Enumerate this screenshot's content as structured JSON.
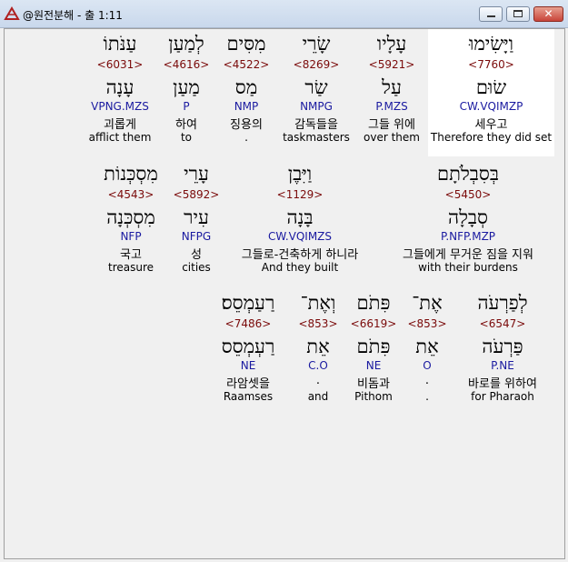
{
  "window": {
    "title": "@원전분해 - 출 1:11"
  },
  "rows": [
    [
      {
        "heb": "וַיָּשִׂימוּ",
        "num": "<7760>",
        "lex": "שׂוּם",
        "mor": "CW.VQIMZP",
        "kor": "세우고",
        "eng": "Therefore they did set"
      },
      {
        "heb": "עָלָיו",
        "num": "<5921>",
        "lex": "עַל",
        "mor": "P.MZS",
        "kor": "그들 위에",
        "eng": "over them"
      },
      {
        "heb": "שָׂרֵי",
        "num": "<8269>",
        "lex": "שַׂר",
        "mor": "NMPG",
        "kor": "감독들을",
        "eng": "taskmasters"
      },
      {
        "heb": "מִסִּים",
        "num": "<4522>",
        "lex": "מַס",
        "mor": "NMP",
        "kor": "징용의",
        "eng": "."
      },
      {
        "heb": "לְמַעַן",
        "num": "<4616>",
        "lex": "מַעַן",
        "mor": "P",
        "kor": "하여",
        "eng": "to"
      },
      {
        "heb": "עַנֹּתוֹ",
        "num": "<6031>",
        "lex": "עָנָה",
        "mor": "VPNG.MZS",
        "kor": "괴롭게",
        "eng": "afflict them"
      }
    ],
    [
      {
        "heb": "בְּסִבְלֹתָם",
        "num": "<5450>",
        "lex": "סְבָלָה",
        "mor": "P.NFP.MZP",
        "kor": "그들에게 무거운 짐을 지워",
        "eng": "with their burdens"
      },
      {
        "heb": "וַיִּבֶן",
        "num": "<1129>",
        "lex": "בָּנָה",
        "mor": "CW.VQIMZS",
        "kor": "그들로-건축하게 하니라",
        "eng": "And they built"
      },
      {
        "heb": "עָרֵי",
        "num": "<5892>",
        "lex": "עִיר",
        "mor": "NFPG",
        "kor": "성",
        "eng": "cities"
      },
      {
        "heb": "מִסְכְּנוֹת",
        "num": "<4543>",
        "lex": "מִסְכְּנָה",
        "mor": "NFP",
        "kor": "국고",
        "eng": "treasure"
      }
    ],
    [
      {
        "heb": "לְפַרְעֹה",
        "num": "<6547>",
        "lex": "פַּרְעֹה",
        "mor": "P.NE",
        "kor": "바로를 위하여",
        "eng": "for Pharaoh"
      },
      {
        "heb": "אֶת־",
        "num": "<853>",
        "lex": "אֵת",
        "mor": "O",
        "kor": ".",
        "eng": "."
      },
      {
        "heb": "פִּתֹם",
        "num": "<6619>",
        "lex": "פִּתֹם",
        "mor": "NE",
        "kor": "비돔과",
        "eng": "Pithom"
      },
      {
        "heb": "וְאֶת־",
        "num": "<853>",
        "lex": "אֵת",
        "mor": "C.O",
        "kor": ".",
        "eng": "and"
      },
      {
        "heb": "רַעַמְסֵס׃",
        "num": "<7486>",
        "lex": "רַעְמְסֵס",
        "mor": "NE",
        "kor": "라암셋을",
        "eng": "Raamses"
      }
    ]
  ]
}
